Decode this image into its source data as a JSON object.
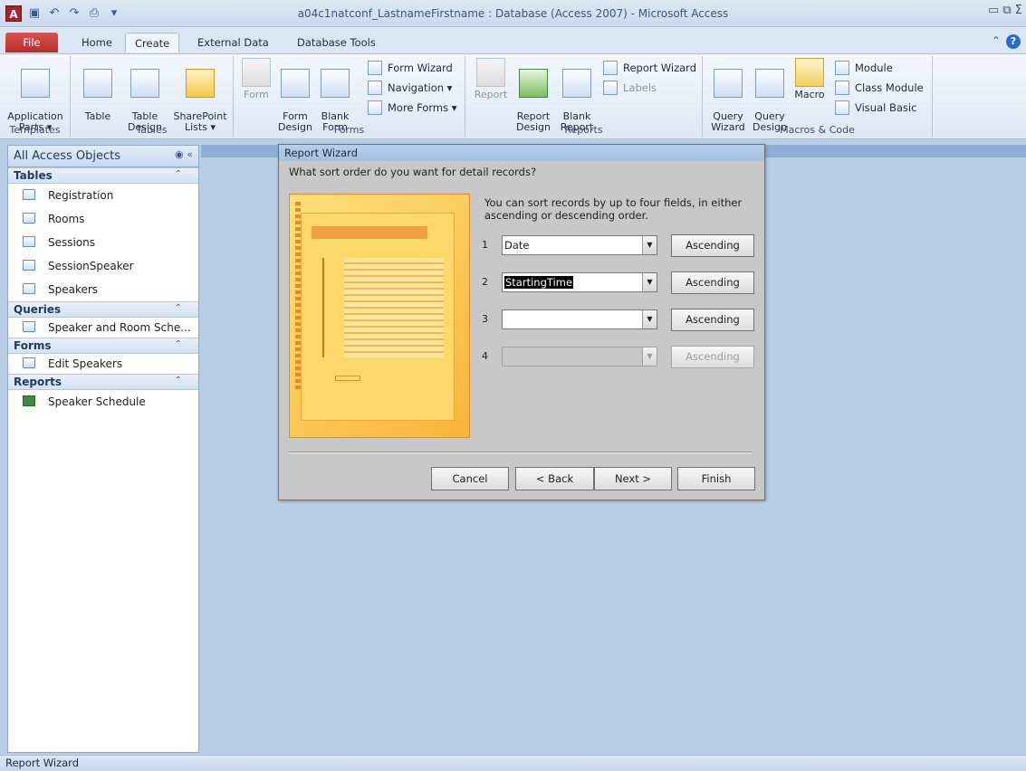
{
  "titlebar": {
    "title": "a04c1natconf_LastnameFirstname : Database (Access 2007)  -  Microsoft Access",
    "window_controls": "▭ ⧉ Σ"
  },
  "tabs": {
    "file": "File",
    "home": "Home",
    "create": "Create",
    "external": "External Data",
    "dbtools": "Database Tools"
  },
  "ribbon": {
    "templates": {
      "label": "Templates",
      "app_parts": "Application\nParts ▾"
    },
    "tables": {
      "label": "Tables",
      "table": "Table",
      "table_design": "Table\nDesign",
      "sharepoint": "SharePoint\nLists ▾"
    },
    "forms": {
      "label": "Forms",
      "form": "Form",
      "form_design": "Form\nDesign",
      "blank_form": "Blank\nForm",
      "form_wizard": "Form Wizard",
      "navigation": "Navigation ▾",
      "more_forms": "More Forms ▾"
    },
    "reports": {
      "label": "Reports",
      "report": "Report",
      "report_design": "Report\nDesign",
      "blank_report": "Blank\nReport",
      "report_wizard": "Report Wizard",
      "labels": "Labels"
    },
    "macros": {
      "label": "Macros & Code",
      "query_wizard": "Query\nWizard",
      "query_design": "Query\nDesign",
      "macro": "Macro",
      "module": "Module",
      "class_module": "Class Module",
      "visual_basic": "Visual Basic"
    }
  },
  "navpane": {
    "title": "All Access Objects",
    "groups": [
      {
        "label": "Tables",
        "items": [
          "Registration",
          "Rooms",
          "Sessions",
          "SessionSpeaker",
          "Speakers"
        ]
      },
      {
        "label": "Queries",
        "items": [
          "Speaker and Room Sche..."
        ]
      },
      {
        "label": "Forms",
        "items": [
          "Edit Speakers"
        ]
      },
      {
        "label": "Reports",
        "items": [
          "Speaker Schedule"
        ]
      }
    ]
  },
  "wizard": {
    "title": "Report Wizard",
    "question": "What sort order do you want for detail records?",
    "hint": "You can sort records by up to four fields, in either ascending or descending order.",
    "rows": [
      {
        "num": "1",
        "field": "Date",
        "order": "Ascending"
      },
      {
        "num": "2",
        "field": "StartingTime",
        "order": "Ascending"
      },
      {
        "num": "3",
        "field": "",
        "order": "Ascending"
      },
      {
        "num": "4",
        "field": "",
        "order": "Ascending"
      }
    ],
    "buttons": {
      "cancel": "Cancel",
      "back": "< Back",
      "next": "Next >",
      "finish": "Finish"
    }
  },
  "statusbar": {
    "text": "Report Wizard"
  }
}
